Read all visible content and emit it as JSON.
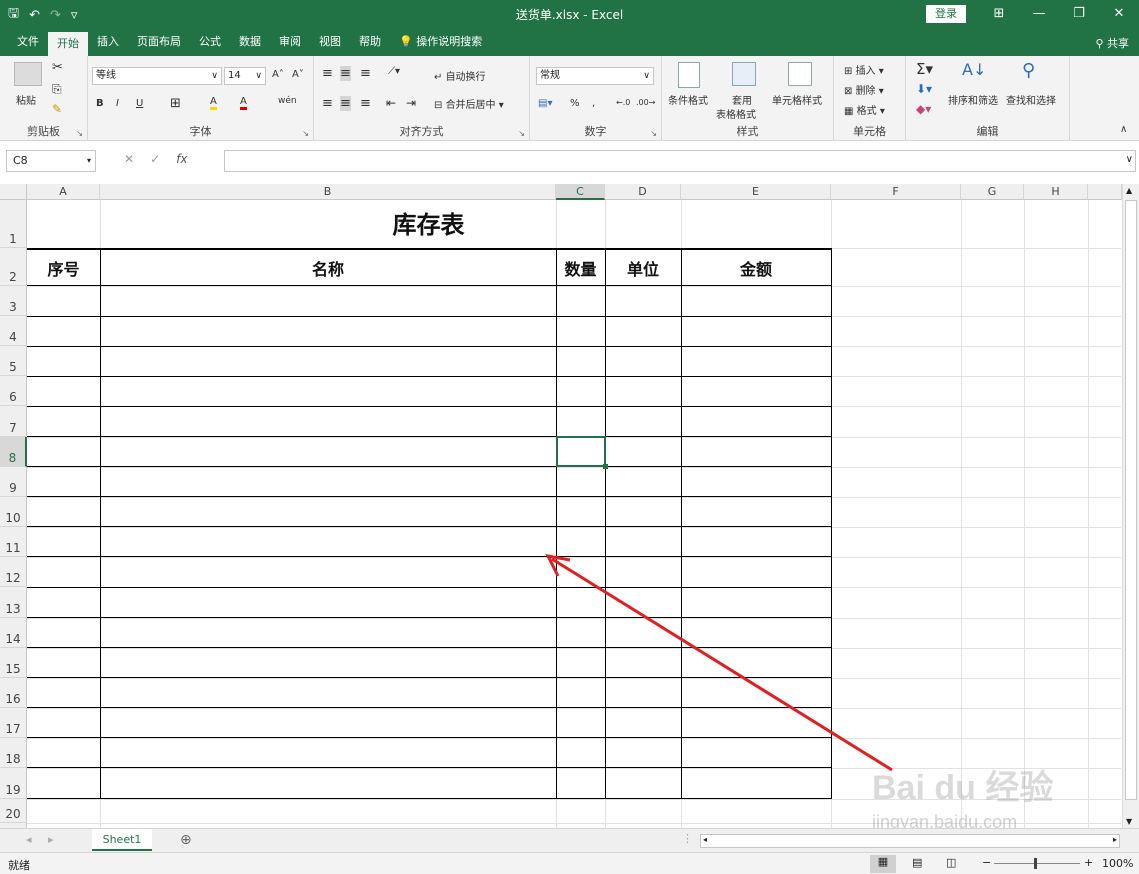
{
  "titlebar": {
    "qat": {
      "save": "🖫",
      "undo": "↶",
      "redo": "↷",
      "customize": "▿"
    },
    "doc_title": "送货单.xlsx  -  Excel",
    "login": "登录",
    "ribbon_display": "⊞",
    "minimize": "—",
    "restore": "❐",
    "close": "✕"
  },
  "menu": {
    "tabs": [
      "文件",
      "开始",
      "插入",
      "页面布局",
      "公式",
      "数据",
      "审阅",
      "视图",
      "帮助",
      "操作说明搜索"
    ],
    "active": "开始",
    "share": "共享"
  },
  "ribbon": {
    "clipboard": {
      "label": "剪贴板",
      "paste": "粘贴"
    },
    "font": {
      "label": "字体",
      "family": "等线",
      "size": "14",
      "bold": "B",
      "italic": "I",
      "underline": "U",
      "grow": "A˄",
      "shrink": "A˅",
      "phonetic": "wén",
      "border": "⊞",
      "fill": "A",
      "color": "A"
    },
    "alignment": {
      "label": "对齐方式",
      "wrap": "自动换行",
      "merge": "合并后居中"
    },
    "number": {
      "label": "数字",
      "format": "常规",
      "percent": "%",
      "comma": ","
    },
    "styles": {
      "label": "样式",
      "conditional": "条件格式",
      "table_line1": "套用",
      "table_line2": "表格格式",
      "cell_styles": "单元格样式"
    },
    "cells": {
      "label": "单元格",
      "insert": "插入",
      "delete": "删除",
      "format": "格式"
    },
    "editing": {
      "label": "编辑",
      "sort": "排序和筛选",
      "find": "查找和选择"
    }
  },
  "formula_bar": {
    "name_box": "C8",
    "cancel": "✕",
    "enter": "✓",
    "fx": "fx",
    "value": ""
  },
  "grid": {
    "columns": [
      "A",
      "B",
      "C",
      "D",
      "E",
      "F",
      "G",
      "H"
    ],
    "selected_column": "C",
    "selected_row": "8",
    "rows": [
      "1",
      "2",
      "3",
      "4",
      "5",
      "6",
      "7",
      "8",
      "9",
      "10",
      "11",
      "12",
      "13",
      "14",
      "15",
      "16",
      "17",
      "18",
      "19",
      "20"
    ]
  },
  "sheet_table": {
    "title": "库存表",
    "headers": [
      "序号",
      "名称",
      "数量",
      "单位",
      "金额"
    ]
  },
  "sheets": {
    "tabs": [
      "Sheet1"
    ],
    "add": "⊕"
  },
  "status": {
    "ready": "就绪",
    "zoom": "100%",
    "minus": "−",
    "plus": "+"
  },
  "watermark": {
    "main": "Bai du 经验",
    "sub": "jingyan.baidu.com"
  },
  "colors": {
    "accent": "#217346",
    "arrow": "#e02020"
  }
}
